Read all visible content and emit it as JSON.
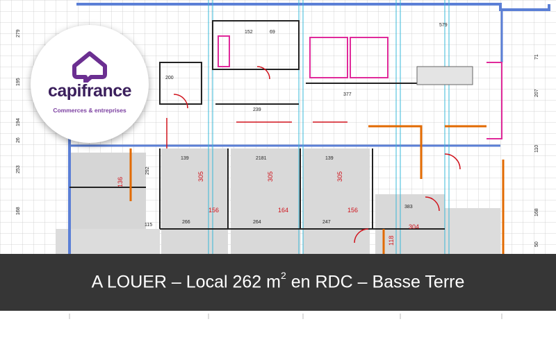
{
  "logo": {
    "brand": "capifrance",
    "tagline": "Commerces & entreprises",
    "colors": {
      "brand_dark": "#3b1f5c",
      "brand_purple": "#7b3fa0"
    }
  },
  "banner": {
    "text_before": "A LOUER – Local 262 m",
    "superscript": "2",
    "text_after": " en RDC – Basse Terre",
    "background": "#363636"
  },
  "plan": {
    "left_dims": [
      "279",
      "195",
      "194",
      "253",
      "168",
      "26"
    ],
    "right_dims": [
      "71",
      "207",
      "110",
      "168",
      "50"
    ],
    "top_dims": [
      "152",
      "69",
      "579"
    ],
    "room_heights": [
      "305",
      "305",
      "305",
      "304"
    ],
    "room_widths": [
      "156",
      "164",
      "156"
    ],
    "lower_dims": [
      "266",
      "264",
      "247",
      "115",
      "383",
      "139",
      "2181",
      "139"
    ],
    "misc_dims": [
      "200",
      "239",
      "377",
      "136",
      "292",
      "118"
    ],
    "colors": {
      "wall_blue": "#5b7fd6",
      "accent_red": "#d0121b",
      "accent_orange": "#e26a00",
      "accent_magenta": "#e0299a",
      "floor_gray": "#d6d6d6"
    }
  }
}
